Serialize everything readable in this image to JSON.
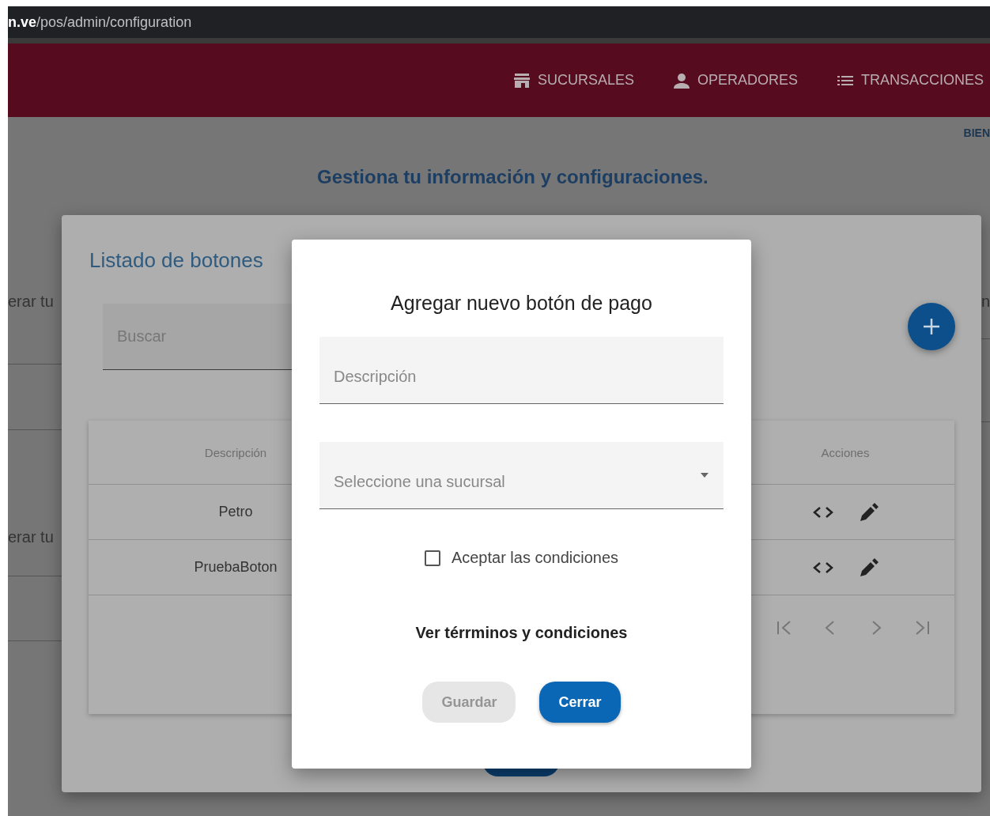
{
  "address_bar": {
    "host": "n.ve",
    "path": "/pos/admin/configuration"
  },
  "nav": [
    {
      "kind": "store",
      "label": "SUCURSALES"
    },
    {
      "kind": "person",
      "label": "OPERADORES"
    },
    {
      "kind": "list",
      "label": "TRANSACCIONES"
    }
  ],
  "greeting": "BIEN",
  "heading": "Gestiona tu información y configuraciones.",
  "left_fragments": [
    "erar tu",
    "erar tu"
  ],
  "right_fragment": "n",
  "list_dialog": {
    "title": "Listado de botones",
    "search": {
      "placeholder": "Buscar"
    },
    "table": {
      "columns": [
        "Descripción",
        "Acciones"
      ],
      "rows": [
        {
          "description": "Petro"
        },
        {
          "description": "PruebaBoton"
        }
      ]
    }
  },
  "add_dialog": {
    "title": "Agregar nuevo botón de pago",
    "fields": [
      {
        "kind": "text",
        "placeholder": "Descripción"
      },
      {
        "kind": "select",
        "placeholder": "Seleccione una sucursal"
      }
    ],
    "checkbox": {
      "label": "Aceptar las condiciones",
      "checked": false
    },
    "terms_link": "Ver térrminos y condiciones",
    "buttons": [
      {
        "label": "Guardar",
        "disabled": true
      },
      {
        "label": "Cerrar",
        "disabled": false
      }
    ]
  }
}
